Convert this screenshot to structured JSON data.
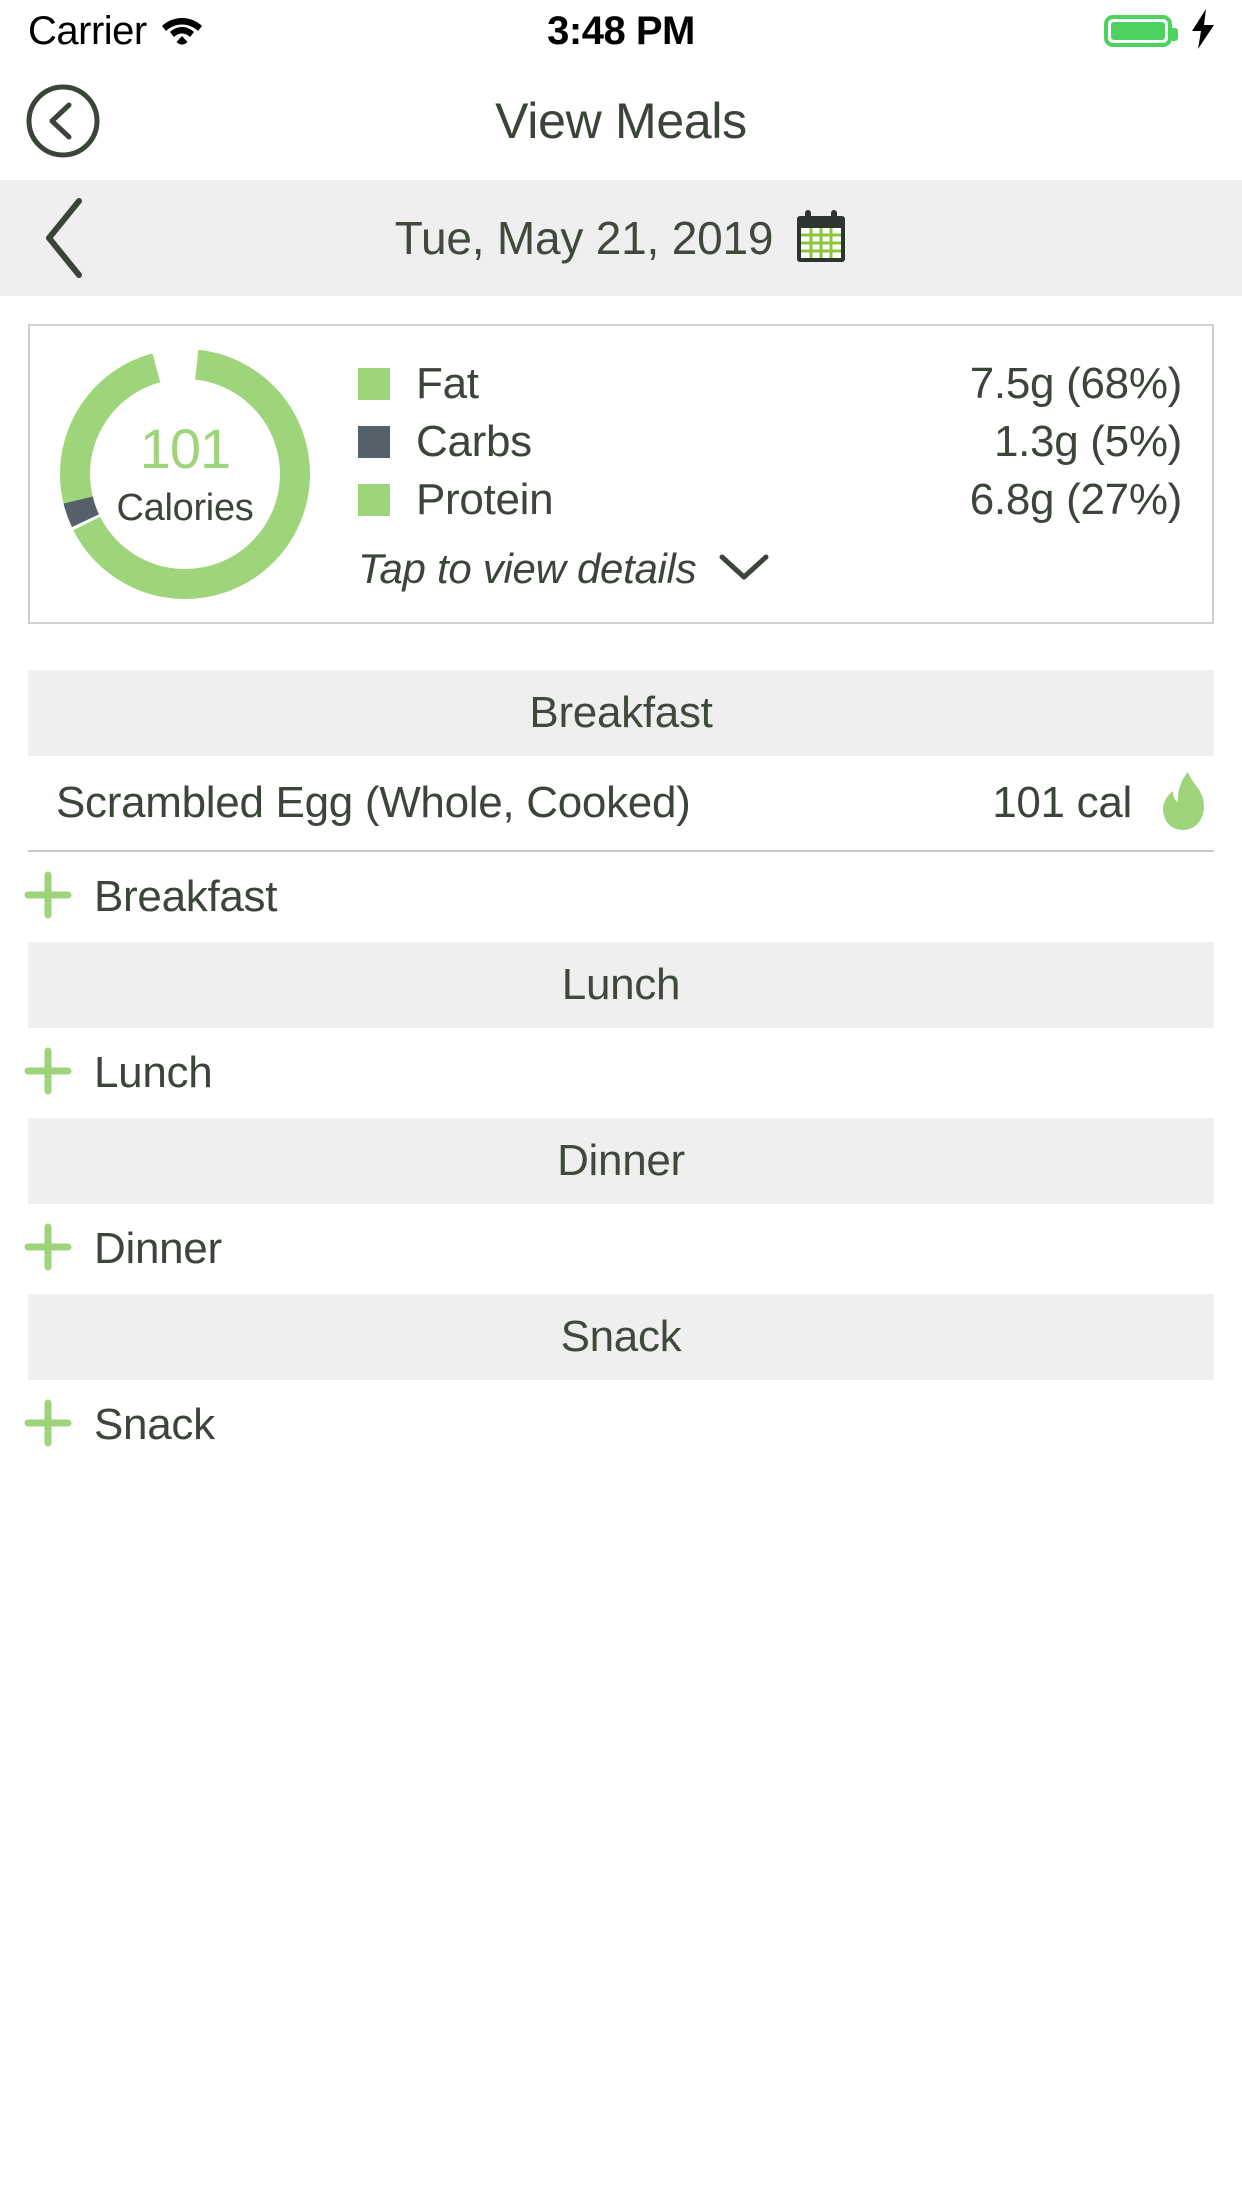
{
  "status_bar": {
    "carrier": "Carrier",
    "time": "3:48 PM",
    "wifi_icon": "wifi-icon",
    "battery_icon": "battery-icon",
    "charging_icon": "lightning-bolt-icon"
  },
  "nav": {
    "back_icon": "circle-chevron-left-icon",
    "title": "View Meals"
  },
  "date_bar": {
    "prev_icon": "chevron-left-icon",
    "date": "Tue, May 21, 2019",
    "calendar_icon": "calendar-icon"
  },
  "summary": {
    "calories_value": "101",
    "calories_label": "Calories",
    "details_text": "Tap to view details",
    "details_icon": "chevron-down-icon",
    "macros": [
      {
        "name": "Fat",
        "value": "7.5g (68%)",
        "color": "#9ed47a"
      },
      {
        "name": "Carbs",
        "value": "1.3g (5%)",
        "color": "#55616a"
      },
      {
        "name": "Protein",
        "value": "6.8g (27%)",
        "color": "#9ed47a"
      }
    ]
  },
  "chart_data": {
    "type": "pie",
    "title": "101 Calories",
    "categories": [
      "Fat",
      "Carbs",
      "Protein"
    ],
    "values": [
      68,
      5,
      27
    ],
    "grams": [
      7.5,
      1.3,
      6.8
    ],
    "colors": [
      "#9ed47a",
      "#55616a",
      "#9ed47a"
    ],
    "center_value": 101,
    "center_label": "Calories",
    "units": "percent of calories",
    "legend": "right"
  },
  "sections": [
    {
      "header": "Breakfast",
      "items": [
        {
          "name": "Scrambled Egg (Whole, Cooked)",
          "calories": "101 cal",
          "icon": "flame-icon"
        }
      ],
      "add_label": "Breakfast",
      "add_icon": "plus-icon"
    },
    {
      "header": "Lunch",
      "items": [],
      "add_label": "Lunch",
      "add_icon": "plus-icon"
    },
    {
      "header": "Dinner",
      "items": [],
      "add_label": "Dinner",
      "add_icon": "plus-icon"
    },
    {
      "header": "Snack",
      "items": [],
      "add_label": "Snack",
      "add_icon": "plus-icon"
    }
  ],
  "colors": {
    "accent_green": "#9ed47a",
    "dark_slate": "#55616a",
    "text_dark": "#3c4539",
    "section_bg": "#efefef",
    "battery_green": "#4cd35f"
  }
}
